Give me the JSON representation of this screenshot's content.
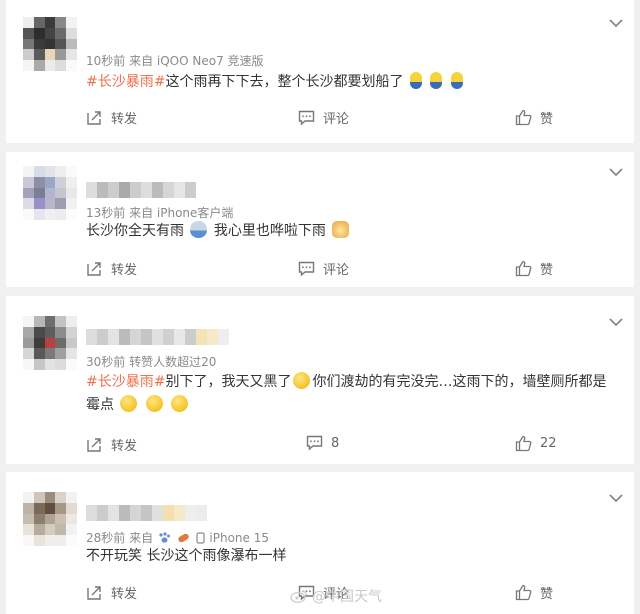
{
  "comments": [
    {
      "meta": "10秒前  来自 iQOO Neo7 竞速版",
      "tag": "#长沙暴雨#",
      "text": "这个雨再下下去，整个长沙都要划船了",
      "emojis": [
        "minion-emoji",
        "minion-emoji",
        "minion-emoji"
      ],
      "actions": {
        "repost": "转发",
        "comment": "评论",
        "like": "赞"
      }
    },
    {
      "meta": "13秒前  来自 iPhone客户端",
      "text_a": "长沙你全天有雨",
      "text_b": "我心里也哗啦下雨",
      "actions": {
        "repost": "转发",
        "comment": "评论",
        "like": "赞"
      }
    },
    {
      "meta": "30秒前 转赞人数超过20",
      "tag": "#长沙暴雨#",
      "text_a": "别下了，我天又黑了",
      "text_b": "你们渡劫的有完没完…这雨下的，墙壁厕所都是霉点",
      "actions": {
        "repost": "转发",
        "comment": "8",
        "like": "22"
      }
    },
    {
      "meta_a": "28秒前  来自",
      "meta_b": "iPhone 15",
      "text": "不开玩笑 长沙这个雨像瀑布一样",
      "actions": {
        "repost": "转发",
        "comment": "评论",
        "like": "赞"
      }
    }
  ],
  "watermark": "@中国天气",
  "colors": {
    "topic": "#eb7350",
    "meta": "#8a8a8a",
    "background": "#f0f0f0"
  }
}
